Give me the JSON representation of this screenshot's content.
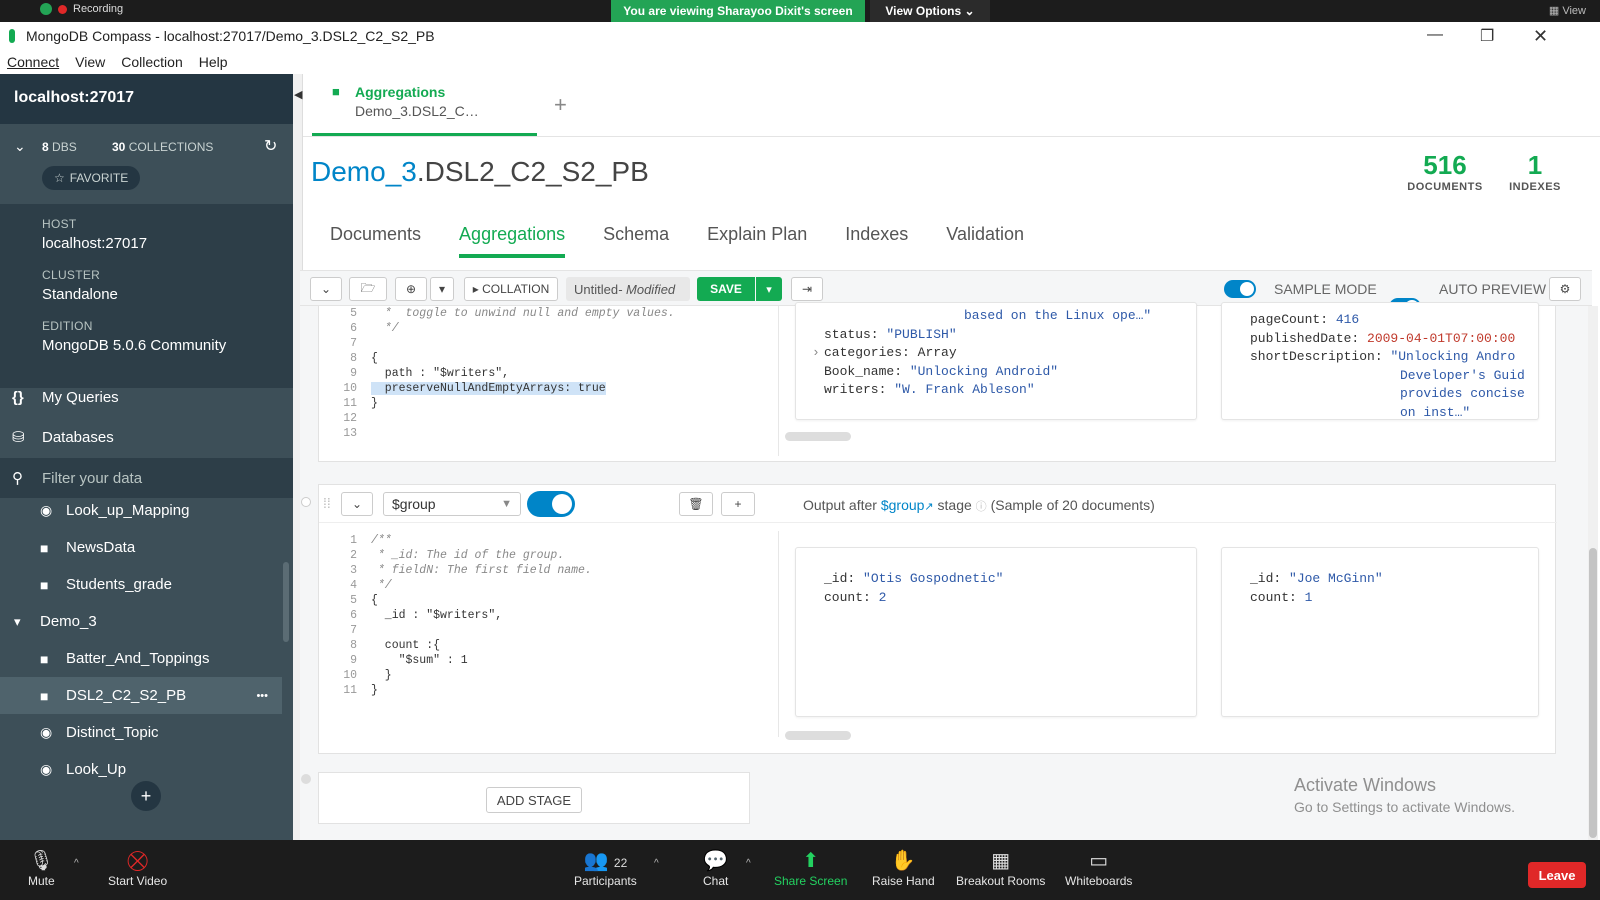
{
  "zoom_top": {
    "recording": "Recording",
    "banner": "You are viewing Sharayoo Dixit's screen",
    "view_options": "View Options",
    "view": "View"
  },
  "window": {
    "title": "MongoDB Compass - localhost:27017/Demo_3.DSL2_C2_S2_PB"
  },
  "menu": [
    "Connect",
    "View",
    "Collection",
    "Help"
  ],
  "sidebar": {
    "host_title": "localhost:27017",
    "dbs_count": "8",
    "dbs_label": "DBS",
    "collections_count": "30",
    "collections_label": "COLLECTIONS",
    "favorite": "FAVORITE",
    "host_label": "HOST",
    "host_value": "localhost:27017",
    "cluster_label": "CLUSTER",
    "cluster_value": "Standalone",
    "edition_label": "EDITION",
    "edition_value": "MongoDB 5.0.6 Community",
    "my_queries": "My Queries",
    "databases": "Databases",
    "filter_placeholder": "Filter your data",
    "tree": [
      {
        "label": "Look_up_Mapping",
        "icon": "eye-icon",
        "level": 2
      },
      {
        "label": "NewsData",
        "icon": "folder-icon",
        "level": 2
      },
      {
        "label": "Students_grade",
        "icon": "folder-icon",
        "level": 2
      },
      {
        "label": "Demo_3",
        "icon": "caret-down-icon",
        "level": 1
      },
      {
        "label": "Batter_And_Toppings",
        "icon": "folder-icon",
        "level": 2
      },
      {
        "label": "DSL2_C2_S2_PB",
        "icon": "folder-icon",
        "level": 2,
        "selected": true
      },
      {
        "label": "Distinct_Topic",
        "icon": "eye-icon",
        "level": 2
      },
      {
        "label": "Look_Up",
        "icon": "eye-icon",
        "level": 2
      }
    ]
  },
  "main": {
    "tab_title": "Aggregations",
    "tab_subtitle": "Demo_3.DSL2_C…",
    "coll_db": "Demo_3",
    "coll_name": ".DSL2_C2_S2_PB",
    "documents_count": "516",
    "documents_label": "DOCUMENTS",
    "indexes_count": "1",
    "indexes_label": "INDEXES",
    "subtabs": [
      "Documents",
      "Aggregations",
      "Schema",
      "Explain Plan",
      "Indexes",
      "Validation"
    ],
    "active_subtab": "Aggregations"
  },
  "toolbar": {
    "collation": "COLLATION",
    "untitled": "Untitled",
    "modified": "- Modified",
    "save": "SAVE",
    "sample_mode": "SAMPLE MODE",
    "auto_preview": "AUTO PREVIEW"
  },
  "stage1": {
    "code": [
      {
        "n": "5",
        "t": "  *  toggle to unwind null and empty values."
      },
      {
        "n": "6",
        "t": "  */"
      },
      {
        "n": "7",
        "t": ""
      },
      {
        "n": "8",
        "t": "{"
      },
      {
        "n": "9",
        "t": "  path : \"$writers\","
      },
      {
        "n": "10",
        "t": "  preserveNullAndEmptyArrays: true"
      },
      {
        "n": "11",
        "t": "}"
      },
      {
        "n": "12",
        "t": ""
      },
      {
        "n": "13",
        "t": ""
      }
    ],
    "card1": {
      "line0": "based on the Linux ope…\"",
      "status_key": "status:",
      "status_val": "\"PUBLISH\"",
      "categories_key": "categories:",
      "categories_val": "Array",
      "book_key": "Book_name:",
      "book_val": "\"Unlocking Android\"",
      "writers_key": "writers:",
      "writers_val": "\"W. Frank Ableson\""
    },
    "card2": {
      "pagecount_key": "pageCount:",
      "pagecount_val": "416",
      "pubdate_key": "publishedDate:",
      "pubdate_val": "2009-04-01T07:00:00",
      "short_key": "shortDescription:",
      "short_val1": "\"Unlocking Andro",
      "short_val2": "Developer's Guid",
      "short_val3": "provides concise",
      "short_val4": "on inst…\""
    }
  },
  "stage2": {
    "operator": "$group",
    "output_prefix": "Output after",
    "output_stage": "$group",
    "output_suffix": "stage",
    "sample_note": "(Sample of 20 documents)",
    "code": [
      {
        "n": "1",
        "t": "/**"
      },
      {
        "n": "2",
        "t": " * _id: The id of the group."
      },
      {
        "n": "3",
        "t": " * fieldN: The first field name."
      },
      {
        "n": "4",
        "t": " */"
      },
      {
        "n": "5",
        "t": "{"
      },
      {
        "n": "6",
        "t": "  _id : \"$writers\","
      },
      {
        "n": "7",
        "t": ""
      },
      {
        "n": "8",
        "t": "  count :{"
      },
      {
        "n": "9",
        "t": "    \"$sum\" : 1"
      },
      {
        "n": "10",
        "t": "  }"
      },
      {
        "n": "11",
        "t": "}"
      }
    ],
    "card1": {
      "id_key": "_id:",
      "id_val": "\"Otis Gospodnetic\"",
      "count_key": "count:",
      "count_val": "2"
    },
    "card2": {
      "id_key": "_id:",
      "id_val": "\"Joe McGinn\"",
      "count_key": "count:",
      "count_val": "1"
    }
  },
  "add_stage": "ADD STAGE",
  "activate": {
    "title": "Activate Windows",
    "subtitle": "Go to Settings to activate Windows."
  },
  "zoom_bottom": {
    "mute": "Mute",
    "start_video": "Start Video",
    "participants": "Participants",
    "participants_count": "22",
    "chat": "Chat",
    "share_screen": "Share Screen",
    "raise_hand": "Raise Hand",
    "breakout_rooms": "Breakout Rooms",
    "whiteboards": "Whiteboards",
    "leave": "Leave"
  },
  "colors": {
    "compass_green": "#13aa52",
    "link_blue": "#0085c8",
    "sidebar_bg": "#3d4f58",
    "zoom_green": "#23a455",
    "leave_red": "#e02828"
  }
}
